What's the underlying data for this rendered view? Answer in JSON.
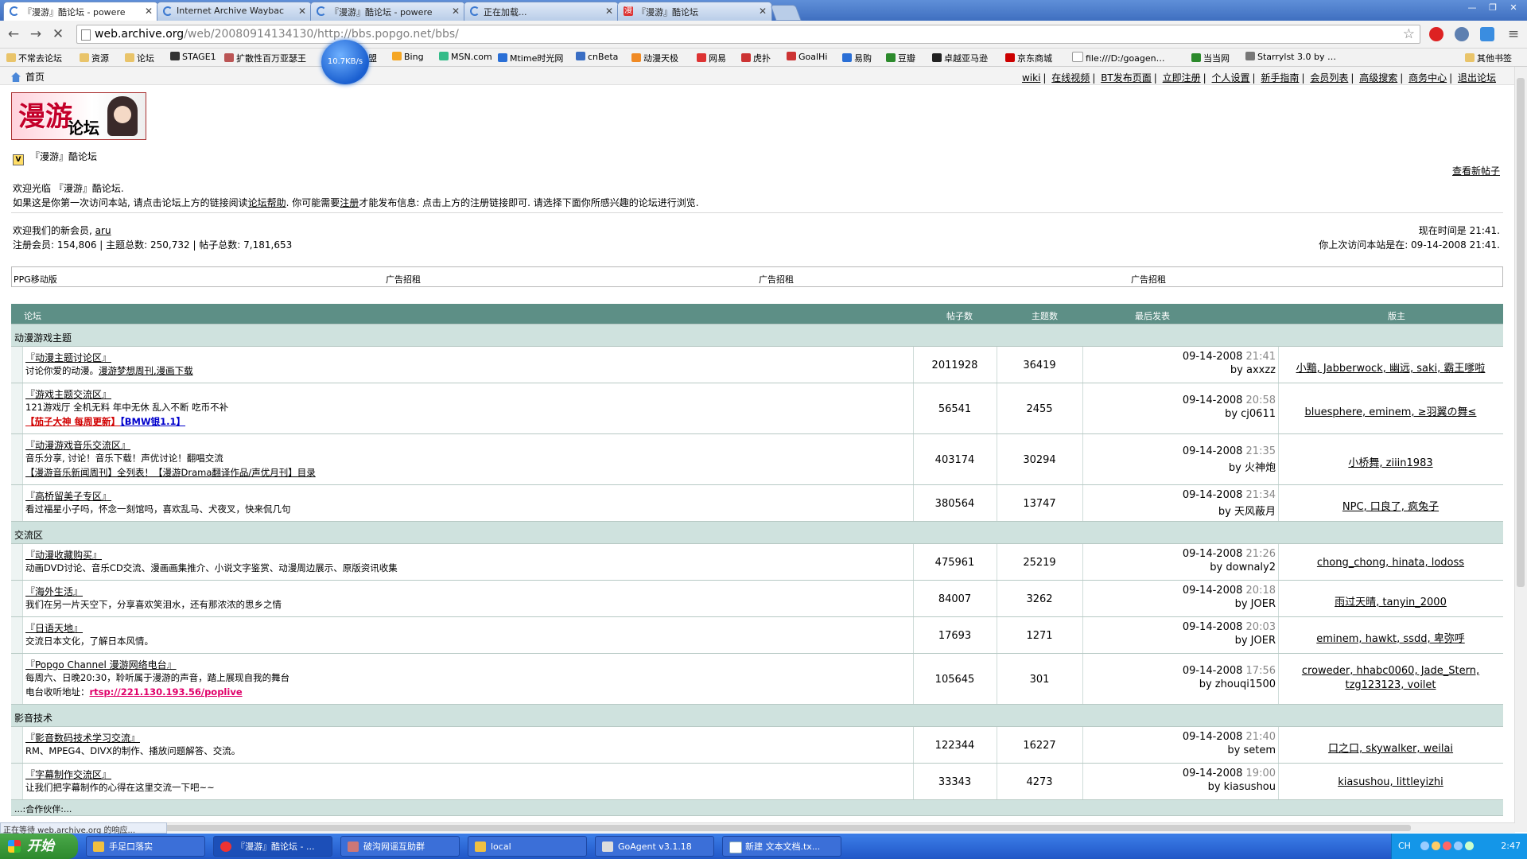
{
  "browser": {
    "tabs": [
      {
        "title": "『漫游』酷论坛 - powere",
        "active": true
      },
      {
        "title": "Internet Archive Waybac",
        "active": false
      },
      {
        "title": "『漫游』酷论坛 - powere",
        "active": false
      },
      {
        "title": "正在加载...",
        "active": false
      },
      {
        "title": "『漫游』酷论坛",
        "active": false
      }
    ],
    "url_host": "web.archive.org",
    "url_rest": "/web/20080914134130/http://bbs.popgo.net/bbs/",
    "speed": "10.7KB/s",
    "bookmarks": [
      "不常去论坛",
      "资源",
      "论坛",
      "STAGE1",
      "扩散性百万亚瑟王",
      "联盟",
      "Bing",
      "MSN.com",
      "Mtime时光网",
      "cnBeta",
      "动漫天极",
      "网易",
      "虎扑",
      "GoalHi",
      "易购",
      "豆瓣",
      "卓越亚马逊",
      "京东商城",
      "file:///D:/goagen…",
      "当当网",
      "Starrylst 3.0 by …",
      "其他书签"
    ],
    "status_text": "正在等待 web.archive.org 的响应..."
  },
  "page": {
    "home_label": "首页",
    "top_links": [
      "wiki",
      "在线视频",
      "BT发布页面",
      "立即注册",
      "个人设置",
      "新手指南",
      "会员列表",
      "高级搜索",
      "商务中心",
      "退出论坛"
    ],
    "logo_big": "漫游",
    "logo_small": "论坛",
    "crumb_icon": "V",
    "breadcrumb": "『漫游』酷论坛",
    "new_posts": "查看新帖子",
    "welcome_line1": "欢迎光临 『漫游』酷论坛.",
    "welcome_line2_pre": "如果这是你第一次访问本站, 请点击论坛上方的链接阅读",
    "welcome_help": "论坛帮助",
    "welcome_line2_mid": ". 你可能需要",
    "welcome_register": "注册",
    "welcome_line2_post": "才能发布信息: 点击上方的注册链接即可. 请选择下面你所感兴趣的论坛进行浏览.",
    "new_member_label": "欢迎我们的新会员,",
    "new_member": "aru",
    "stats": "注册会员: 154,806 | 主题总数: 250,732 | 帖子总数: 7,181,653",
    "now_time": "现在时间是 21:41.",
    "last_visit": "你上次访问本站是在: 09-14-2008 21:41.",
    "ads": [
      "PPG移动版",
      "广告招租",
      "广告招租",
      "广告招租"
    ],
    "table_header": {
      "forum": "论坛",
      "posts": "帖子数",
      "threads": "主题数",
      "last_post": "最后发表",
      "mods": "版主"
    },
    "categories": [
      {
        "name": "动漫游戏主题",
        "forums": [
          {
            "title": "『动漫主题讨论区』",
            "desc": "讨论你爱的动漫。",
            "desc_link": "漫游梦想周刊,漫画下载",
            "extra": "",
            "posts": "2011928",
            "threads": "36419",
            "last_date": "09-14-2008",
            "last_time": "21:41",
            "last_by": "by axxzz",
            "mods": "小黯, Jabberwock, 幽远, saki, 霸王嗲啦",
            "mods2": ""
          },
          {
            "title": "『游戏主题交流区』",
            "desc": "121游戏厅 全机无料 年中无休 乱入不断 吃币不补",
            "desc_link": "",
            "extra_red": "【茄子大神 每周更新】",
            "extra_blue": "【BMW银1.1】",
            "posts": "56541",
            "threads": "2455",
            "last_date": "09-14-2008",
            "last_time": "20:58",
            "last_by": "by cj0611",
            "mods": "bluesphere, eminem, ≥羽翼の舞≤",
            "mods2": ""
          },
          {
            "title": "『动漫游戏音乐交流区』",
            "desc": "音乐分享, 讨论！音乐下载！声优讨论！翻唱交流",
            "desc_link": "",
            "extra_line": "【漫游音乐新闻周刊】全列表！【漫游Drama翻译作品/声优月刊】目录",
            "posts": "403174",
            "threads": "30294",
            "last_date": "09-14-2008",
            "last_time": "21:35",
            "last_by": "by 火神炮",
            "mods": "小桥舞, ziiin1983",
            "mods2": ""
          },
          {
            "title": "『高桥留美子专区』",
            "desc": "看过福星小子吗，怀念一刻馆吗，喜欢乱马、犬夜叉，快来侃几句",
            "desc_link": "",
            "extra": "",
            "posts": "380564",
            "threads": "13747",
            "last_date": "09-14-2008",
            "last_time": "21:34",
            "last_by": "by 天风蔽月",
            "mods": "NPC, 口良了, 疯兔子",
            "mods2": ""
          }
        ]
      },
      {
        "name": "交流区",
        "forums": [
          {
            "title": "『动漫收藏购买』",
            "desc": "动画DVD讨论、音乐CD交流、漫画画集推介、小说文字鉴赏、动漫周边展示、原版资讯收集",
            "desc_link": "",
            "extra": "",
            "posts": "475961",
            "threads": "25219",
            "last_date": "09-14-2008",
            "last_time": "21:26",
            "last_by": "by downaly2",
            "mods": "chong_chong, hinata, lodoss",
            "mods2": ""
          },
          {
            "title": "『海外生活』",
            "desc": "我们在另一片天空下，分享喜欢笑泪水，还有那浓浓的思乡之情",
            "desc_link": "",
            "extra": "",
            "posts": "84007",
            "threads": "3262",
            "last_date": "09-14-2008",
            "last_time": "20:18",
            "last_by": "by JOER",
            "mods": "雨过天晴, tanyin_2000",
            "mods2": ""
          },
          {
            "title": "『日语天地』",
            "desc": "交流日本文化，了解日本风情。",
            "desc_link": "",
            "extra": "",
            "posts": "17693",
            "threads": "1271",
            "last_date": "09-14-2008",
            "last_time": "20:03",
            "last_by": "by JOER",
            "mods": "eminem, hawkt, ssdd, 卑弥呼",
            "mods2": ""
          },
          {
            "title": "『Popgo Channel 漫游网络电台』",
            "desc": "每周六、日晚20:30，聆听属于漫游的声音，踏上展现自我的舞台",
            "desc_link": "",
            "radio_label": "电台收听地址：",
            "radio_url": "rtsp://221.130.193.56/poplive",
            "posts": "105645",
            "threads": "301",
            "last_date": "09-14-2008",
            "last_time": "17:56",
            "last_by": "by zhouqi1500",
            "mods": "croweder, hhabc0060, Jade_Stern,",
            "mods2": "tzg123123, voilet"
          }
        ]
      },
      {
        "name": "影音技术",
        "forums": [
          {
            "title": "『影音数码技术学习交流』",
            "desc": "RM、MPEG4、DIVX的制作、播放问题解答、交流。",
            "desc_link": "",
            "extra": "",
            "posts": "122344",
            "threads": "16227",
            "last_date": "09-14-2008",
            "last_time": "21:40",
            "last_by": "by setem",
            "mods": "口之口, skywalker, weilai",
            "mods2": ""
          },
          {
            "title": "『字幕制作交流区』",
            "desc": "让我们把字幕制作的心得在这里交流一下吧~~",
            "desc_link": "",
            "extra": "",
            "posts": "33343",
            "threads": "4273",
            "last_date": "09-14-2008",
            "last_time": "19:00",
            "last_by": "by kiasushou",
            "mods": "kiasushou, littleyizhi",
            "mods2": ""
          }
        ]
      }
    ],
    "partner_label": "...:合作伙伴:..."
  },
  "taskbar": {
    "start": "开始",
    "items": [
      "手足口落实",
      "『漫游』酷论坛 - ...",
      "破沟网谣互助群",
      "local",
      "GoAgent v3.1.18",
      "新建 文本文档.tx..."
    ],
    "lang": "CH",
    "clock": "2:47"
  }
}
